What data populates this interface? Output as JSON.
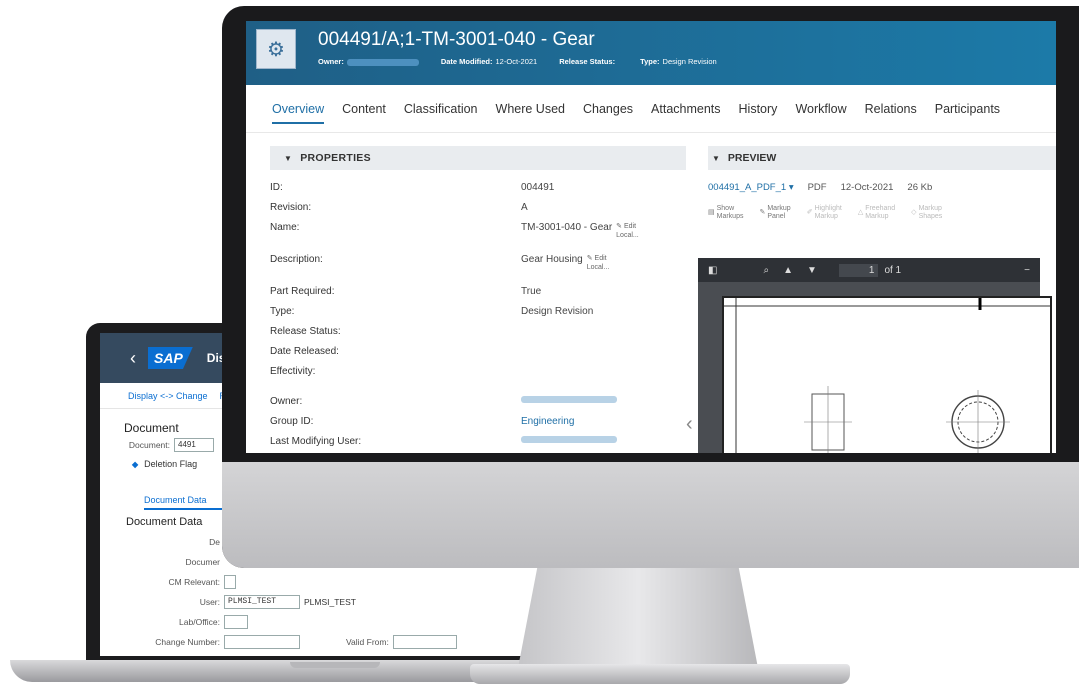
{
  "sap": {
    "shell_title": "Disp",
    "toolbar": {
      "display_change": "Display <-> Change",
      "next": "Re"
    },
    "section_document": "Document",
    "document_label": "Document:",
    "document_value": "4491",
    "deletion_flag": "Deletion Flag",
    "tab_document_data": "Document Data",
    "tab_next": "I",
    "subsection": "Document Data",
    "fields": {
      "de": "De",
      "documer": "Documer",
      "cm_relevant": "CM Relevant:",
      "user_label": "User:",
      "user_value": "PLMSI_TEST",
      "user_desc": "PLMSI_TEST",
      "lab_office": "Lab/Office:",
      "change_number": "Change Number:",
      "valid_from": "Valid From:"
    }
  },
  "tc": {
    "title": "004491/A;1-TM-3001-040 - Gear",
    "meta": {
      "owner_label": "Owner:",
      "date_modified_label": "Date Modified:",
      "date_modified_value": "12-Oct-2021",
      "release_status_label": "Release Status:",
      "type_label": "Type:",
      "type_value": "Design Revision"
    },
    "tabs": [
      "Overview",
      "Content",
      "Classification",
      "Where Used",
      "Changes",
      "Attachments",
      "History",
      "Workflow",
      "Relations",
      "Participants"
    ],
    "properties_title": "PROPERTIES",
    "properties": [
      {
        "label": "ID:",
        "value": "004491"
      },
      {
        "label": "Revision:",
        "value": "A"
      },
      {
        "label": "Name:",
        "value": "TM-3001-040 - Gear"
      },
      {
        "label": "Description:",
        "value": "Gear Housing"
      },
      {
        "label": "Part Required:",
        "value": "True"
      },
      {
        "label": "Type:",
        "value": "Design Revision"
      },
      {
        "label": "Release Status:",
        "value": ""
      },
      {
        "label": "Date Released:",
        "value": ""
      },
      {
        "label": "Effectivity:",
        "value": ""
      },
      {
        "label": "Owner:",
        "value": ""
      },
      {
        "label": "Group ID:",
        "value": "Engineering"
      },
      {
        "label": "Last Modifying User:",
        "value": ""
      }
    ],
    "edit_local_1": "Edit",
    "edit_local_2": "Local...",
    "preview_title": "PREVIEW",
    "preview_file": {
      "name": "004491_A_PDF_1",
      "type": "PDF",
      "date": "12-Oct-2021",
      "size": "26 Kb"
    },
    "preview_tools": [
      {
        "l1": "Show",
        "l2": "Markups"
      },
      {
        "l1": "Markup",
        "l2": "Panel"
      },
      {
        "l1": "Highlight",
        "l2": "Markup"
      },
      {
        "l1": "Freehand",
        "l2": "Markup"
      },
      {
        "l1": "Markup",
        "l2": "Shapes"
      }
    ],
    "pdf": {
      "page": "1",
      "of": "of 1"
    }
  }
}
